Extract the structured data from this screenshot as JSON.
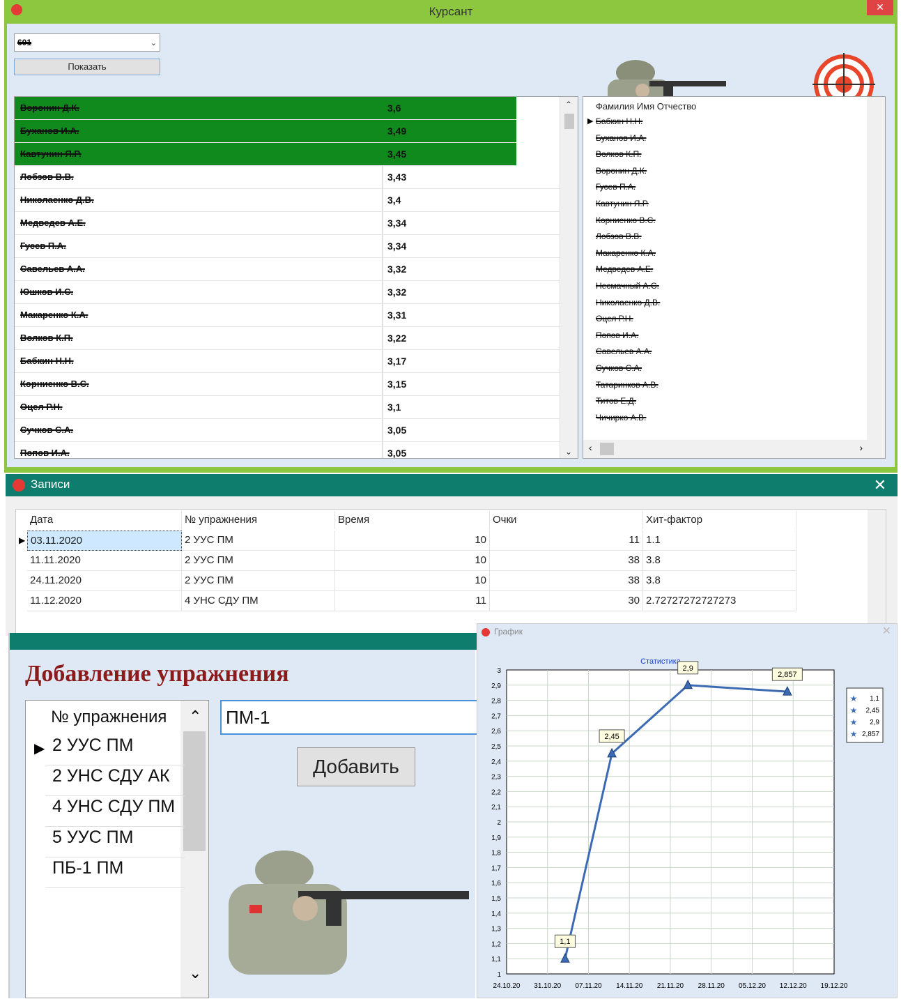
{
  "window1": {
    "title": "Курсант",
    "close": "✕",
    "group_select": {
      "value": "601"
    },
    "show_button": "Показать",
    "ranking": [
      {
        "name": "Воронин Д.К.",
        "score": "3,6",
        "highlight": true
      },
      {
        "name": "Буханов И.А.",
        "score": "3,49",
        "highlight": true
      },
      {
        "name": "Кавтунин Я.Р.",
        "score": "3,45",
        "highlight": true
      },
      {
        "name": "Лобзов В.В.",
        "score": "3,43"
      },
      {
        "name": "Николаенко Д.В.",
        "score": "3,4"
      },
      {
        "name": "Медведев А.Е.",
        "score": "3,34"
      },
      {
        "name": "Гусев П.А.",
        "score": "3,34"
      },
      {
        "name": "Савельев А.А.",
        "score": "3,32"
      },
      {
        "name": "Юшков И.С.",
        "score": "3,32"
      },
      {
        "name": "Макаренко К.А.",
        "score": "3,31"
      },
      {
        "name": "Волков К.П.",
        "score": "3,22"
      },
      {
        "name": "Бабкин Н.Н.",
        "score": "3,17"
      },
      {
        "name": "Корниенко В.С.",
        "score": "3,15"
      },
      {
        "name": "Оцел Р.Н.",
        "score": "3,1"
      },
      {
        "name": "Сучков С.А.",
        "score": "3,05"
      },
      {
        "name": "Попов И.А.",
        "score": "3,05"
      }
    ],
    "names_header": "Фамилия Имя Отчество",
    "names": [
      "Бабкин Н.Н.",
      "Буханов И.А.",
      "Волков К.П.",
      "Воронин Д.К.",
      "Гусев П.А.",
      "Кавтунин Я.Р.",
      "Корниенко В.С.",
      "Лобзов В.В.",
      "Макаренко К.А.",
      "Медведев А.Е.",
      "Несмачный А.С.",
      "Николаенко Д.В.",
      "Оцел Р.Н.",
      "Попов И.А.",
      "Савельев А.А.",
      "Сучков С.А.",
      "Татаринков А.В.",
      "Титов Е.Д.",
      "Чичирко А.В."
    ]
  },
  "window2": {
    "title": "Записи",
    "close": "✕",
    "columns": [
      "Дата",
      "№ упражнения",
      "Время",
      "Очки",
      "Хит-фактор"
    ],
    "rows": [
      [
        "03.11.2020",
        "2 УУС ПМ",
        "10",
        "11",
        "1.1"
      ],
      [
        "11.11.2020",
        "2 УУС ПМ",
        "10",
        "38",
        "3.8"
      ],
      [
        "24.11.2020",
        "2 УУС ПМ",
        "10",
        "38",
        "3.8"
      ],
      [
        "11.12.2020",
        "4 УНС СДУ ПМ",
        "11",
        "30",
        "2.72727272727273"
      ]
    ]
  },
  "window3": {
    "heading": "Добавление упражнения",
    "list_header": "№ упражнения",
    "exercises": [
      "2 УУС ПМ",
      "2 УНС СДУ АК",
      "4 УНС СДУ ПМ",
      "5 УУС ПМ",
      "ПБ-1 ПМ"
    ],
    "input_value": "ПМ-1",
    "add_button": "Добавить"
  },
  "window4": {
    "title": "График",
    "close": "✕"
  },
  "chart_data": {
    "type": "line",
    "title": "Статистика",
    "x": [
      "2020-11-03",
      "2020-11-11",
      "2020-11-24",
      "2020-12-11"
    ],
    "series": [
      {
        "values": [
          1.1,
          2.45,
          2.9,
          2.857
        ],
        "labels": [
          "1,1",
          "2,45",
          "2,9",
          "2,857"
        ]
      }
    ],
    "x_ticks": [
      "24.10.20",
      "31.10.20",
      "07.11.20",
      "14.11.20",
      "21.11.20",
      "28.11.20",
      "05.12.20",
      "12.12.20",
      "19.12.20"
    ],
    "y_ticks": [
      "1",
      "1,1",
      "1,2",
      "1,3",
      "1,4",
      "1,5",
      "1,6",
      "1,7",
      "1,8",
      "1,9",
      "2",
      "2,1",
      "2,2",
      "2,3",
      "2,4",
      "2,5",
      "2,6",
      "2,7",
      "2,8",
      "2,9",
      "3"
    ],
    "ylim": [
      1,
      3
    ],
    "grid": true,
    "legend_position": "right",
    "legend": [
      "1,1",
      "2,45",
      "2,9",
      "2,857"
    ],
    "colors": {
      "line": "#3d6bb3",
      "marker": "#3d6bb3",
      "title": "#1a3fc4"
    }
  }
}
